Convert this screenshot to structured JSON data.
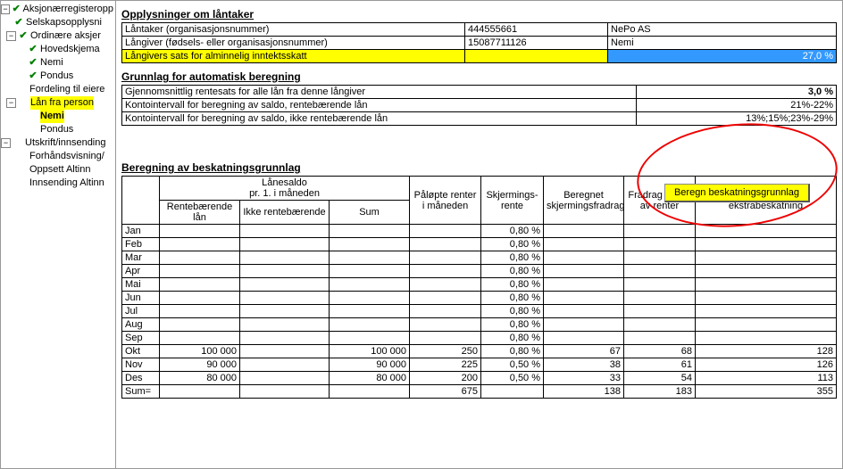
{
  "tree": {
    "n0": "Aksjonærregisteropp",
    "n1": "Selskapsopplysni",
    "n2": "Ordinære aksjer",
    "n3": "Hovedskjema",
    "n4": "Nemi",
    "n5": "Pondus",
    "n6": "Fordeling til eiere",
    "n7": "Lån fra person",
    "n8": "Nemi",
    "n9": "Pondus",
    "n10": "Utskrift/innsending",
    "n11": "Forhåndsvisning/",
    "n12": "Oppsett Altinn",
    "n13": "Innsending Altinn"
  },
  "sec1": {
    "title": "Opplysninger om låntaker",
    "r1l": "Låntaker (organisasjonsnummer)",
    "r1v1": "444555661",
    "r1v2": "NePo AS",
    "r2l": "Långiver (fødsels- eller organisasjonsnummer)",
    "r2v1": "15087711126",
    "r2v2": "Nemi",
    "r3l": "Långivers sats for alminnelig inntektsskatt",
    "r3v": "27,0 %"
  },
  "sec2": {
    "title": "Grunnlag for automatisk beregning",
    "r1l": "Gjennomsnittlig rentesats for alle lån fra denne långiver",
    "r1v": "3,0 %",
    "r2l": "Kontointervall for beregning av saldo, rentebærende lån",
    "r2v": "21%-22%",
    "r3l": "Kontointervall for beregning av saldo, ikke rentebærende lån",
    "r3v": "13%;15%;23%-29%"
  },
  "btn": "Beregn beskatningsgrunnlag",
  "sec3": {
    "title": "Beregning av beskatningsgrunnlag",
    "h_saldo": "Lånesaldo\npr. 1. i måneden",
    "h_rb": "Rentebærende lån",
    "h_irb": "Ikke rentebærende",
    "h_sum": "Sum",
    "h_pal": "Påløpte renter i måneden",
    "h_skj": "Skjermings-rente",
    "h_ber": "Beregnet skjermingsfradrag",
    "h_fra": "Fradrag i skatt av renter",
    "h_ri": "Renteinntekt til ekstrabeskatning"
  },
  "months": [
    "Jan",
    "Feb",
    "Mar",
    "Apr",
    "Mai",
    "Jun",
    "Jul",
    "Aug",
    "Sep",
    "Okt",
    "Nov",
    "Des",
    "Sum="
  ],
  "rows": {
    "Jan": {
      "skj": "0,80 %"
    },
    "Feb": {
      "skj": "0,80 %"
    },
    "Mar": {
      "skj": "0,80 %"
    },
    "Apr": {
      "skj": "0,80 %"
    },
    "Mai": {
      "skj": "0,80 %"
    },
    "Jun": {
      "skj": "0,80 %"
    },
    "Jul": {
      "skj": "0,80 %"
    },
    "Aug": {
      "skj": "0,80 %"
    },
    "Sep": {
      "skj": "0,80 %"
    },
    "Okt": {
      "rb": "100 000",
      "sum": "100 000",
      "pal": "250",
      "skj": "0,80 %",
      "ber": "67",
      "fra": "68",
      "ri": "128"
    },
    "Nov": {
      "rb": "90 000",
      "sum": "90 000",
      "pal": "225",
      "skj": "0,50 %",
      "ber": "38",
      "fra": "61",
      "ri": "126"
    },
    "Des": {
      "rb": "80 000",
      "sum": "80 000",
      "pal": "200",
      "skj": "0,50 %",
      "ber": "33",
      "fra": "54",
      "ri": "113"
    },
    "Sum=": {
      "pal": "675",
      "ber": "138",
      "fra": "183",
      "ri": "355"
    }
  }
}
